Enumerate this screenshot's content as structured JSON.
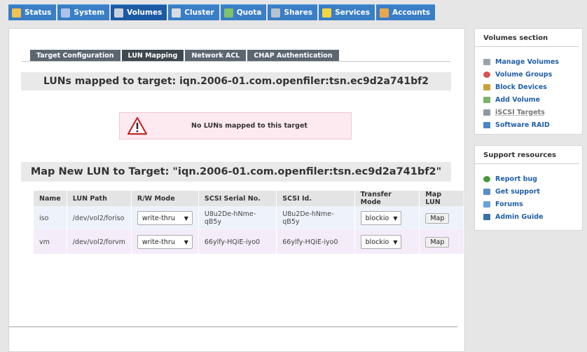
{
  "nav": {
    "tabs": [
      {
        "label": "Status",
        "icon": "status-icon",
        "color": "#f2c14e"
      },
      {
        "label": "System",
        "icon": "system-icon",
        "color": "#a9c4e8"
      },
      {
        "label": "Volumes",
        "icon": "volumes-icon",
        "color": "#c9d2db"
      },
      {
        "label": "Cluster",
        "icon": "cluster-icon",
        "color": "#d8dde3"
      },
      {
        "label": "Quota",
        "icon": "quota-icon",
        "color": "#7fc26b"
      },
      {
        "label": "Shares",
        "icon": "shares-icon",
        "color": "#b7c3cf"
      },
      {
        "label": "Services",
        "icon": "services-icon",
        "color": "#f5d442"
      },
      {
        "label": "Accounts",
        "icon": "accounts-icon",
        "color": "#e8a84a"
      }
    ],
    "active": "Volumes"
  },
  "subtabs": [
    "Target Configuration",
    "LUN Mapping",
    "Network ACL",
    "CHAP Authentication"
  ],
  "mapped_heading": "LUNs mapped to target: iqn.2006-01.com.openfiler:tsn.ec9d2a741bf2",
  "warning": "No LUNs mapped to this target",
  "map_heading": "Map New LUN to Target: \"iqn.2006-01.com.openfiler:tsn.ec9d2a741bf2\"",
  "table": {
    "headers": [
      "Name",
      "LUN Path",
      "R/W Mode",
      "SCSI Serial No.",
      "SCSI Id.",
      "Transfer Mode",
      "Map LUN"
    ],
    "rows": [
      {
        "name": "iso",
        "path": "/dev/vol2/foriso",
        "rw": "write-thru",
        "serial": "U8u2De-hNme-qB5y",
        "id": "U8u2De-hNme-qB5y",
        "transfer": "blockio",
        "button": "Map"
      },
      {
        "name": "vm",
        "path": "/dev/vol2/forvm",
        "rw": "write-thru",
        "serial": "66ylfy-HQiE-iyo0",
        "id": "66ylfy-HQiE-iyo0",
        "transfer": "blockio",
        "button": "Map"
      }
    ]
  },
  "sidebar_volumes": {
    "title": "Volumes section",
    "items": [
      {
        "label": "Manage Volumes",
        "icon": "manage-volumes-icon",
        "color": "#9aa4ad"
      },
      {
        "label": "Volume Groups",
        "icon": "volume-groups-icon",
        "color": "#d9534f"
      },
      {
        "label": "Block Devices",
        "icon": "block-devices-icon",
        "color": "#c7a23a"
      },
      {
        "label": "Add Volume",
        "icon": "add-volume-icon",
        "color": "#7bb46a"
      },
      {
        "label": "iSCSI Targets",
        "icon": "iscsi-targets-icon",
        "color": "#8e98a2"
      },
      {
        "label": "Software RAID",
        "icon": "software-raid-icon",
        "color": "#4a86c5"
      }
    ]
  },
  "sidebar_support": {
    "title": "Support resources",
    "items": [
      {
        "label": "Report bug",
        "icon": "report-bug-icon",
        "color": "#4a9a3c"
      },
      {
        "label": "Get support",
        "icon": "get-support-icon",
        "color": "#5a8fc8"
      },
      {
        "label": "Forums",
        "icon": "forums-icon",
        "color": "#6aa3d8"
      },
      {
        "label": "Admin Guide",
        "icon": "admin-guide-icon",
        "color": "#3b6fa8"
      }
    ]
  }
}
